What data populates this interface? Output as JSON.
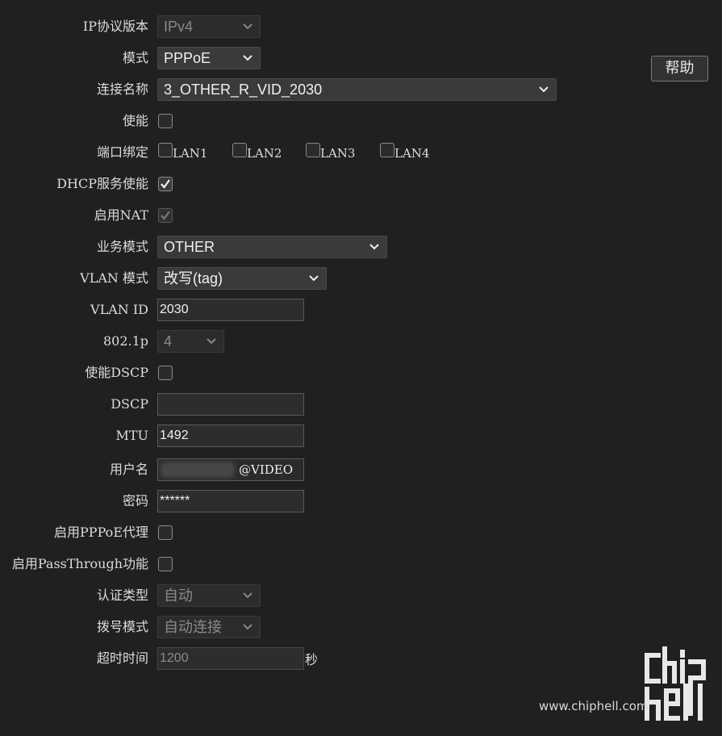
{
  "help_button": "帮助",
  "fields": {
    "ip_version": {
      "label": "IP协议版本",
      "value": "IPv4"
    },
    "mode": {
      "label": "模式",
      "value": "PPPoE"
    },
    "connection_name": {
      "label": "连接名称",
      "value": "3_OTHER_R_VID_2030"
    },
    "enable": {
      "label": "使能",
      "checked": false
    },
    "port_binding": {
      "label": "端口绑定",
      "ports": [
        "LAN1",
        "LAN2",
        "LAN3",
        "LAN4"
      ]
    },
    "dhcp_service": {
      "label": "DHCP服务使能",
      "checked": true
    },
    "nat": {
      "label": "启用NAT",
      "checked": true
    },
    "service_mode": {
      "label": "业务模式",
      "value": "OTHER"
    },
    "vlan_mode": {
      "label": "VLAN 模式",
      "value": "改写(tag)"
    },
    "vlan_id": {
      "label": "VLAN ID",
      "value": "2030"
    },
    "dot1p": {
      "label": "802.1p",
      "value": "4"
    },
    "enable_dscp": {
      "label": "使能DSCP",
      "checked": false
    },
    "dscp": {
      "label": "DSCP",
      "value": ""
    },
    "mtu": {
      "label": "MTU",
      "value": "1492"
    },
    "username": {
      "label": "用户名",
      "value": "@VIDEO"
    },
    "password": {
      "label": "密码",
      "value": "******"
    },
    "pppoe_proxy": {
      "label": "启用PPPoE代理",
      "checked": false
    },
    "passthrough": {
      "label": "启用PassThrough功能",
      "checked": false
    },
    "auth_type": {
      "label": "认证类型",
      "value": "自动"
    },
    "dial_mode": {
      "label": "拨号模式",
      "value": "自动连接"
    },
    "timeout": {
      "label": "超时时间",
      "value": "1200",
      "unit": "秒"
    }
  },
  "watermark": {
    "logo": "chiphell",
    "url": "www.chiphell.com"
  }
}
